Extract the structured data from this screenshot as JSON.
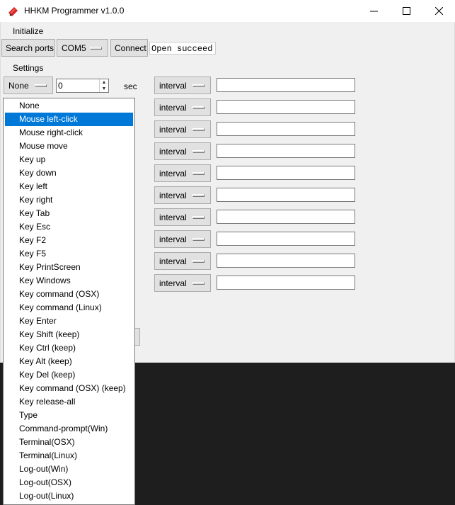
{
  "window": {
    "title": "HHKM Programmer v1.0.0",
    "icon": "hhkm-keyboard-icon"
  },
  "menubar": {
    "initialize": "Initialize"
  },
  "connection": {
    "search_ports": "Search ports",
    "port": "COM5",
    "connect": "Connect",
    "status": "Open succeed"
  },
  "settings": {
    "label": "Settings",
    "first_action": "None",
    "delay_value": "0",
    "delay_unit": "sec",
    "interval_label": "interval",
    "interval_rows": 10
  },
  "dropdown": {
    "selected_index": 1,
    "items": [
      "None",
      "Mouse left-click",
      "Mouse right-click",
      "Mouse move",
      "Key up",
      "Key down",
      "Key left",
      "Key right",
      "Key Tab",
      "Key Esc",
      "Key F2",
      "Key F5",
      "Key PrintScreen",
      "Key Windows",
      "Key command (OSX)",
      "Key command (Linux)",
      "Key Enter",
      "Key Shift (keep)",
      "Key Ctrl (keep)",
      "Key Alt (keep)",
      "Key Del (keep)",
      "Key command (OSX) (keep)",
      "Key release-all",
      "Type",
      "Command-prompt(Win)",
      "Terminal(OSX)",
      "Terminal(Linux)",
      "Log-out(Win)",
      "Log-out(OSX)",
      "Log-out(Linux)"
    ]
  }
}
